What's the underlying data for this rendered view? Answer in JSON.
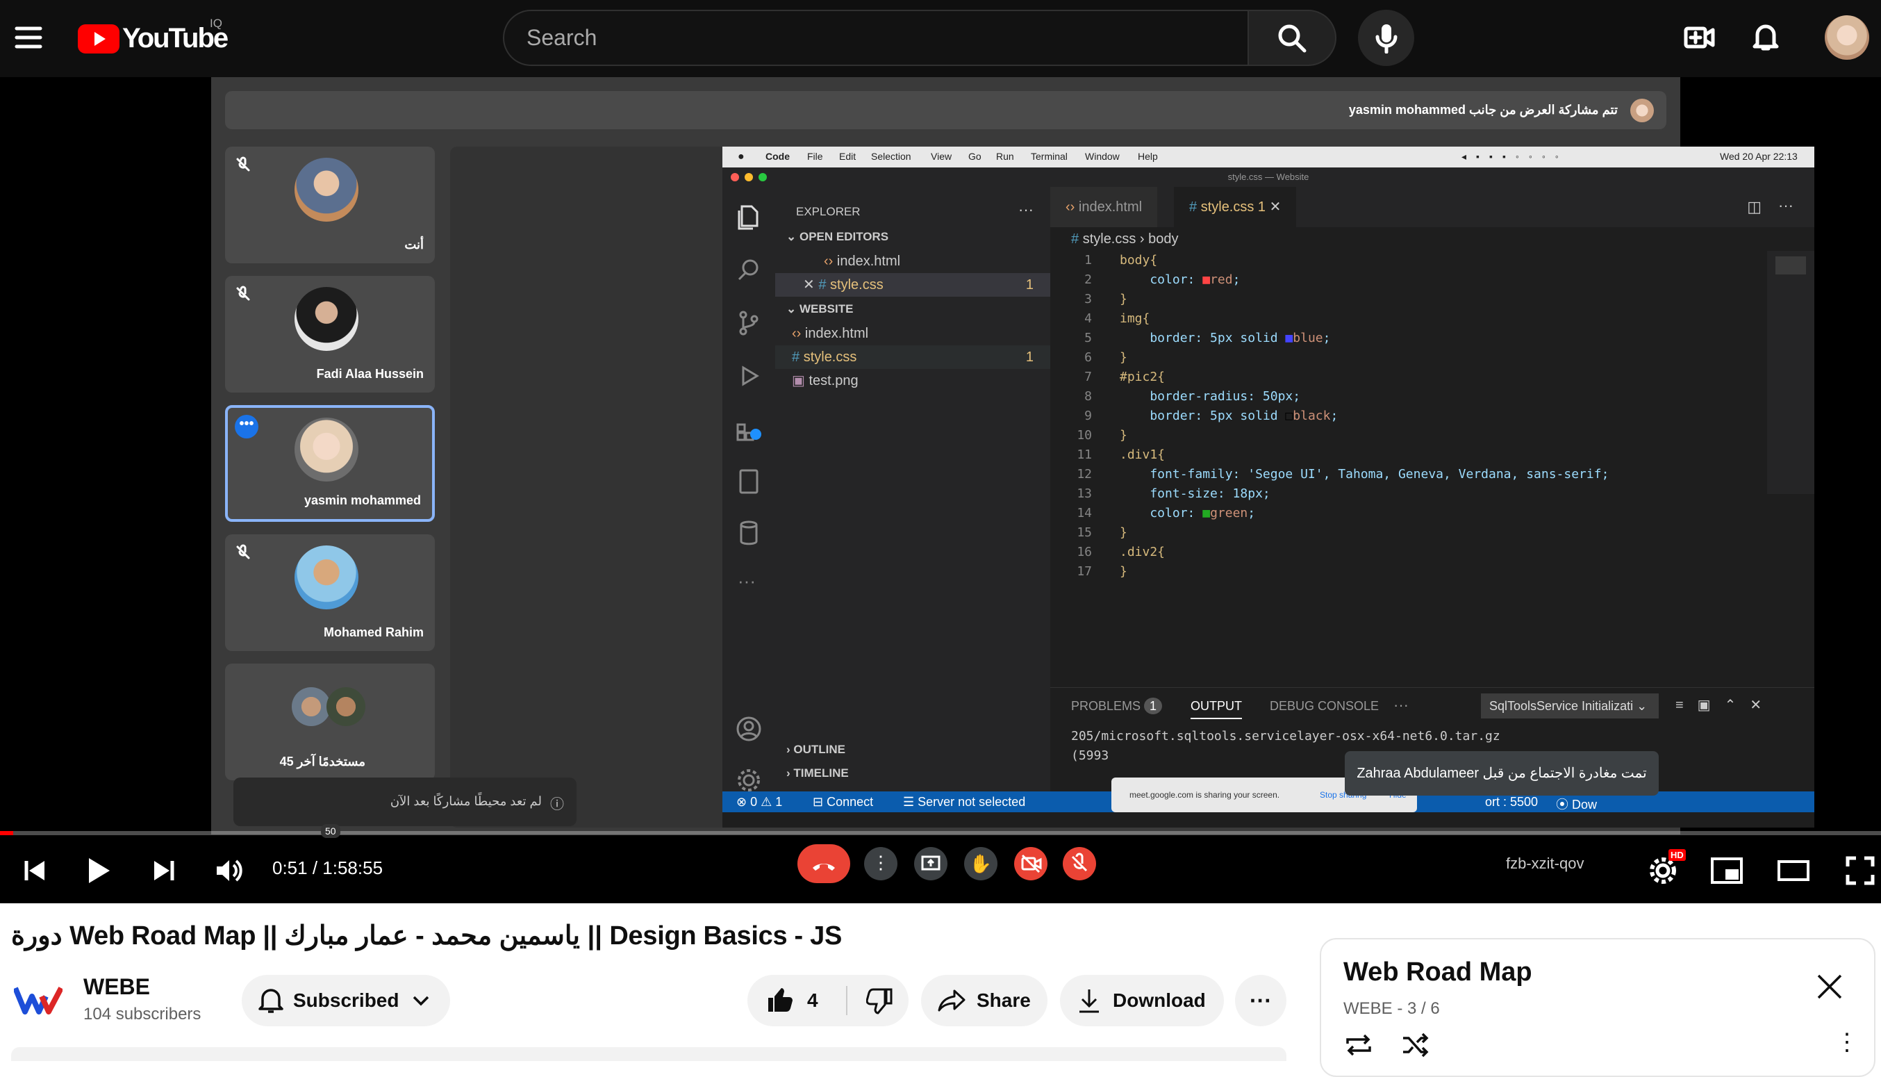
{
  "youtube": {
    "logo_text": "YouTube",
    "country_code": "IQ",
    "search_placeholder": "Search"
  },
  "meet": {
    "share_banner": "yasmin mohammed تتم مشاركة العرض من جانب",
    "participants": [
      {
        "name": "أنت"
      },
      {
        "name": "Fadi Alaa Hussein"
      },
      {
        "name": "yasmin mohammed"
      },
      {
        "name": "Mohamed Rahim"
      },
      {
        "name": "45 مستخدمًا آخر"
      }
    ],
    "bottom_notice": "لم تعد محيطًا مشاركًا بعد الآن",
    "toast": "Zahraa Abdulameer تمت مغادرة الاجتماع من قبل",
    "meeting_code": "fzb-xzit-qov",
    "badge_count": "50",
    "screen_share_bar": {
      "text": "meet.google.com is sharing your screen.",
      "stop": "Stop sharing",
      "hide": "Hide"
    }
  },
  "vscode": {
    "menu": [
      "Code",
      "File",
      "Edit",
      "Selection",
      "View",
      "Go",
      "Run",
      "Terminal",
      "Window",
      "Help"
    ],
    "clock": "Wed 20 Apr 22:13",
    "window_title": "style.css — Website",
    "explorer": {
      "header": "EXPLORER",
      "open_editors": "OPEN EDITORS",
      "open_files": [
        "index.html",
        "style.css"
      ],
      "folder": "WEBSITE",
      "files": [
        "index.html",
        "style.css",
        "test.png"
      ],
      "badge": "1",
      "outline": "OUTLINE",
      "timeline": "TIMELINE"
    },
    "tabs": [
      "index.html",
      "style.css 1"
    ],
    "breadcrumb": [
      "style.css",
      "body"
    ],
    "code": [
      {
        "n": "1",
        "t": "body{"
      },
      {
        "n": "2",
        "t": "    color: ■red;"
      },
      {
        "n": "3",
        "t": "}"
      },
      {
        "n": "4",
        "t": "img{"
      },
      {
        "n": "5",
        "t": "    border: 5px solid ■blue;"
      },
      {
        "n": "6",
        "t": "}"
      },
      {
        "n": "7",
        "t": "#pic2{"
      },
      {
        "n": "8",
        "t": "    border-radius: 50px;"
      },
      {
        "n": "9",
        "t": "    border: 5px solid □black;"
      },
      {
        "n": "10",
        "t": "}"
      },
      {
        "n": "11",
        "t": ".div1{"
      },
      {
        "n": "12",
        "t": "    font-family: 'Segoe UI', Tahoma, Geneva, Verdana, sans-serif;"
      },
      {
        "n": "13",
        "t": "    font-size: 18px;"
      },
      {
        "n": "14",
        "t": "    color: ■green;"
      },
      {
        "n": "15",
        "t": "}"
      },
      {
        "n": "16",
        "t": ".div2{"
      },
      {
        "n": "17",
        "t": "}"
      }
    ],
    "panel": {
      "tabs": [
        "PROBLEMS",
        "OUTPUT",
        "DEBUG CONSOLE"
      ],
      "problems_count": "1",
      "channel": "SqlToolsService Initializati",
      "output_lines": [
        "205/microsoft.sqltools.servicelayer-osx-x64-net6.0.tar.gz",
        "(5993"
      ]
    },
    "status": {
      "errors": "0",
      "warnings": "1",
      "connect": "Connect",
      "server": "Server not selected",
      "port": "ort : 5500",
      "go_live": "Dow"
    }
  },
  "player": {
    "time_current": "0:51",
    "time_total": "1:58:55",
    "progress_fraction": 0.007,
    "hd_badge": "HD"
  },
  "video": {
    "title": "دورة Web Road Map || ياسمين محمد - عمار مبارك || Design Basics - JS",
    "channel_name": "WEBE",
    "subscribers": "104 subscribers",
    "subscribed_label": "Subscribed",
    "like_count": "4",
    "share_label": "Share",
    "download_label": "Download"
  },
  "playlist": {
    "title": "Web Road Map",
    "subtitle": "WEBE - 3 / 6"
  },
  "colors": {
    "accent": "#ff0000",
    "vscode_status": "#0b5cad",
    "meet_red": "#ea4335"
  }
}
